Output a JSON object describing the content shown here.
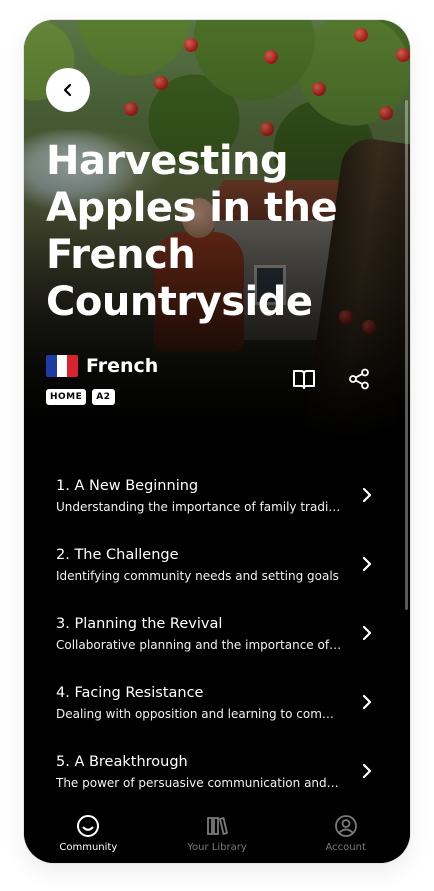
{
  "hero": {
    "title": "Harvesting Apples in the French Countryside",
    "language": "French",
    "badges": [
      "HOME",
      "A2"
    ],
    "flag_colors": [
      "#1f3ba3",
      "#ffffff",
      "#d9232e"
    ]
  },
  "actions": {
    "back_icon": "chevron-left-icon",
    "read_icon": "open-book-icon",
    "share_icon": "share-icon"
  },
  "chapters": [
    {
      "title": "1. A New Beginning",
      "description": "Understanding the importance of family traditions"
    },
    {
      "title": "2. The Challenge",
      "description": "Identifying community needs and setting goals"
    },
    {
      "title": "3. Planning the Revival",
      "description": "Collaborative planning and the importance of teamwork"
    },
    {
      "title": "4. Facing Resistance",
      "description": "Dealing with opposition and learning to communicate"
    },
    {
      "title": "5. A Breakthrough",
      "description": "The power of persuasive communication and trust"
    }
  ],
  "tabbar": {
    "tabs": [
      {
        "label": "Community",
        "icon": "smiley-face-icon",
        "active": true
      },
      {
        "label": "Your Library",
        "icon": "library-books-icon",
        "active": false
      },
      {
        "label": "Account",
        "icon": "user-circle-icon",
        "active": false
      }
    ],
    "active_color": "#ffffff",
    "inactive_color": "#7a7a7a"
  }
}
